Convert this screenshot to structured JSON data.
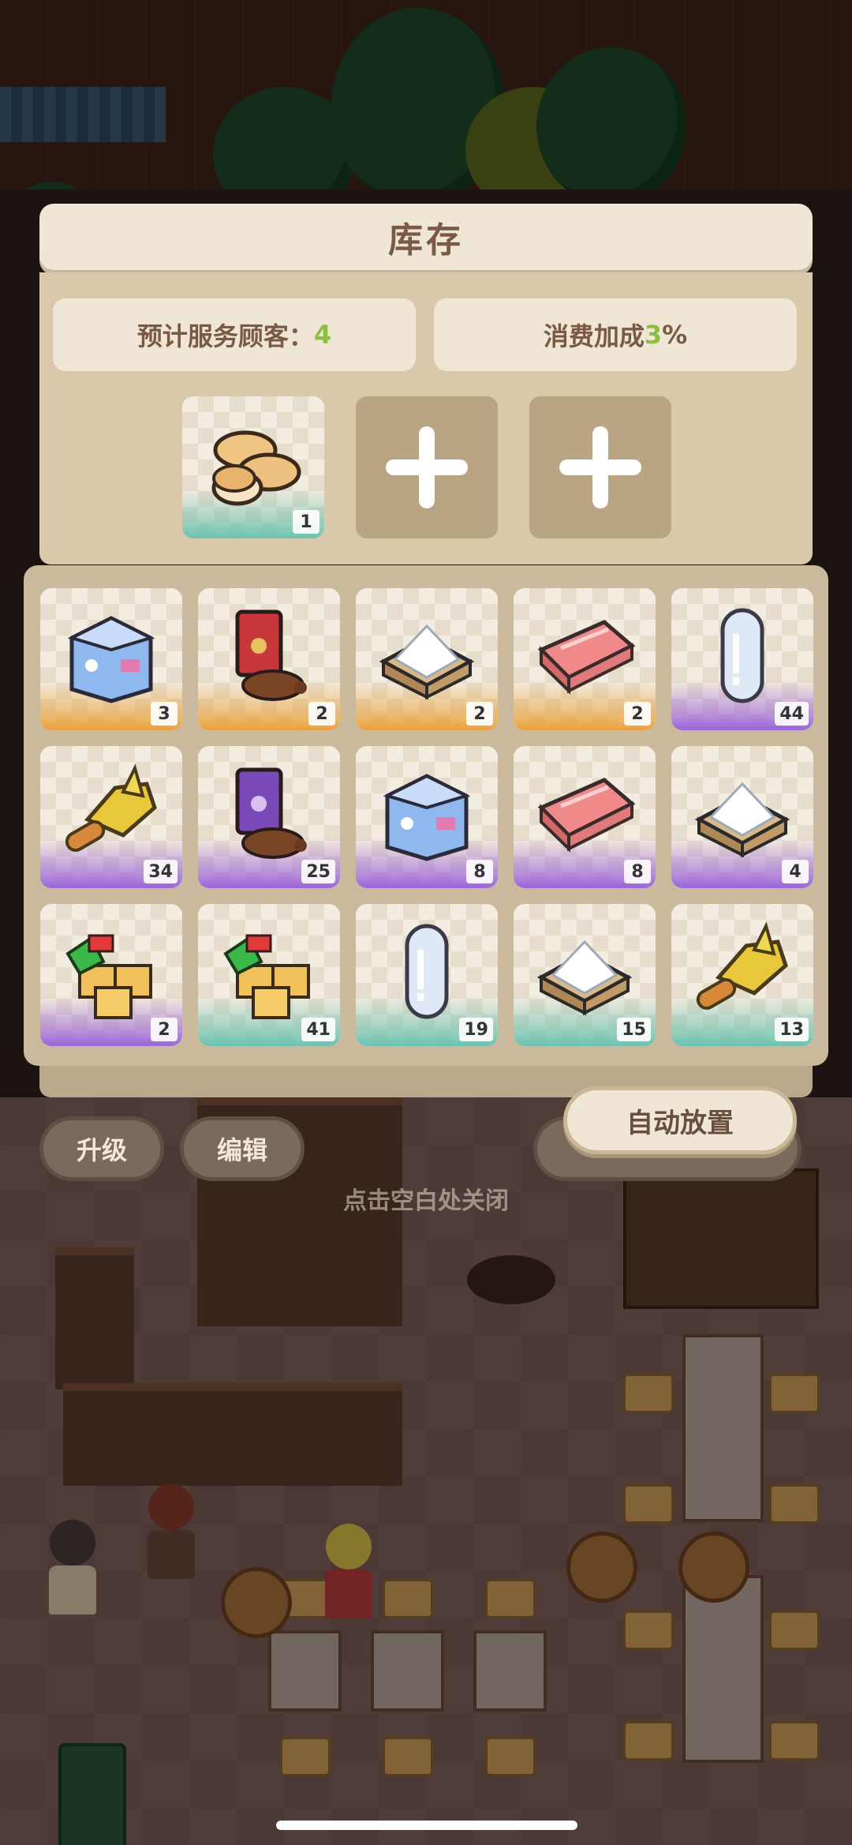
{
  "inventory": {
    "title": "库存",
    "expected_customers_label": "预计服务顾客：",
    "expected_customers_value": "4",
    "consumption_bonus_label": "消费加成",
    "consumption_bonus_value": "3",
    "consumption_bonus_unit": "%",
    "placed_slots": [
      {
        "item": "bread-rolls",
        "count": "1"
      },
      {
        "item": "empty-slot"
      },
      {
        "item": "empty-slot"
      }
    ],
    "items": [
      {
        "item": "milk-carton",
        "count": "3",
        "rarity": "orange"
      },
      {
        "item": "coffee-bag",
        "count": "2",
        "rarity": "orange"
      },
      {
        "item": "flour-box",
        "count": "2",
        "rarity": "orange"
      },
      {
        "item": "meat-slab",
        "count": "2",
        "rarity": "orange"
      },
      {
        "item": "water-bottle",
        "count": "44",
        "rarity": "purple"
      },
      {
        "item": "fried-chicken",
        "count": "34",
        "rarity": "purple"
      },
      {
        "item": "coffee-bag-purple",
        "count": "25",
        "rarity": "purple"
      },
      {
        "item": "milk-carton",
        "count": "8",
        "rarity": "purple"
      },
      {
        "item": "meat-slab",
        "count": "8",
        "rarity": "purple"
      },
      {
        "item": "flour-box",
        "count": "4",
        "rarity": "purple"
      },
      {
        "item": "tofu-veg",
        "count": "2",
        "rarity": "purple"
      },
      {
        "item": "tofu-veg",
        "count": "41",
        "rarity": "teal"
      },
      {
        "item": "water-bottle",
        "count": "19",
        "rarity": "teal"
      },
      {
        "item": "flour-box",
        "count": "15",
        "rarity": "teal"
      },
      {
        "item": "fried-chicken",
        "count": "13",
        "rarity": "teal"
      }
    ],
    "auto_place_label": "自动放置"
  },
  "background": {
    "upgrade_label": "升级",
    "edit_label": "编辑",
    "hint_text": "点击空白处关闭"
  },
  "colors": {
    "orange": "#e9a23b",
    "purple": "#9b64d9",
    "teal": "#6cc2b0",
    "accent_green": "#8bbf3f"
  }
}
